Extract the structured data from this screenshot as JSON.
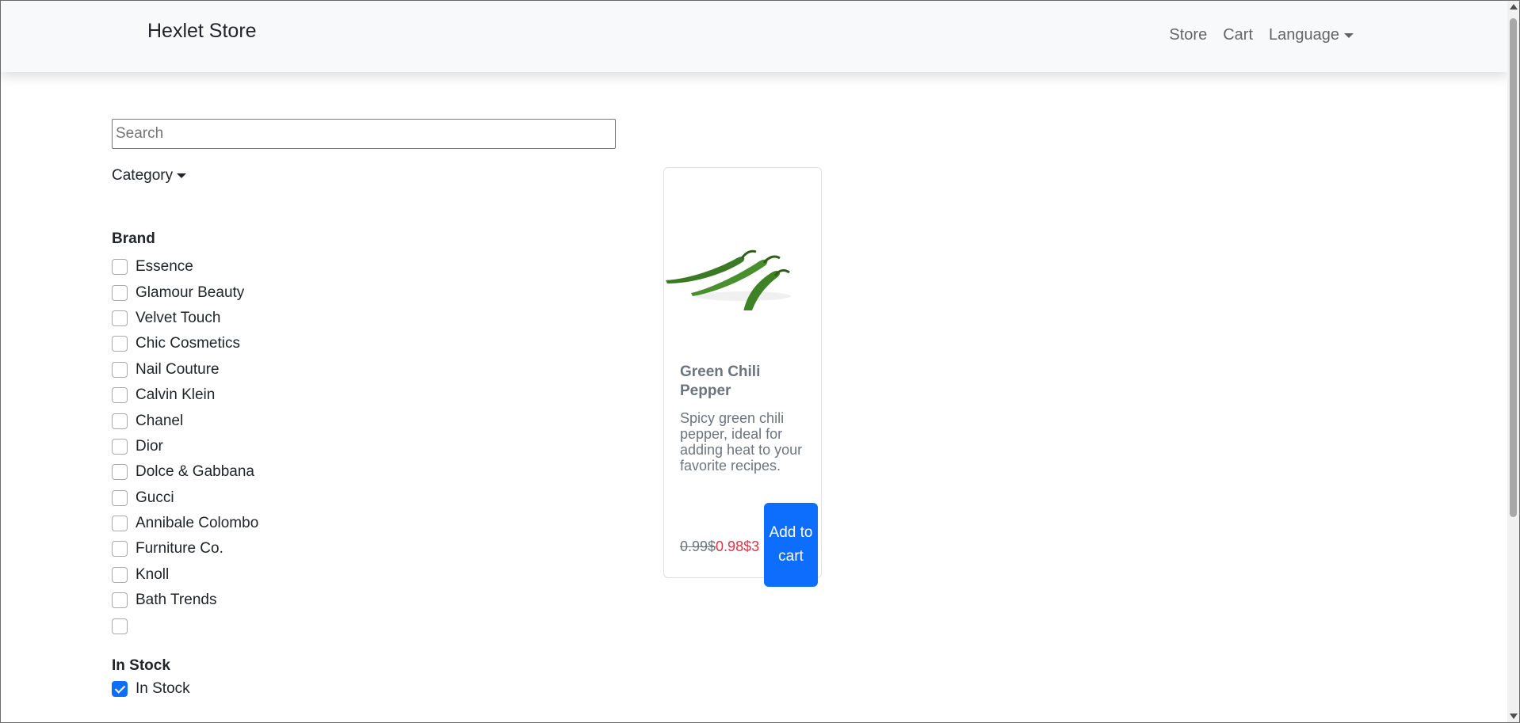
{
  "navbar": {
    "brand": "Hexlet Store",
    "links": {
      "store": "Store",
      "cart": "Cart",
      "language": "Language"
    }
  },
  "search": {
    "placeholder": "Search",
    "value": ""
  },
  "category": {
    "label": "Category"
  },
  "filters": {
    "brand_title": "Brand",
    "brands": [
      "Essence",
      "Glamour Beauty",
      "Velvet Touch",
      "Chic Cosmetics",
      "Nail Couture",
      "Calvin Klein",
      "Chanel",
      "Dior",
      "Dolce & Gabbana",
      "Gucci",
      "Annibale Colombo",
      "Furniture Co.",
      "Knoll",
      "Bath Trends",
      ""
    ],
    "stock_title": "In Stock",
    "stock_label": "In Stock",
    "stock_checked": true
  },
  "product": {
    "title": "Green Chili Pepper",
    "description": "Spicy green chili pepper, ideal for adding heat to your favorite recipes.",
    "old_price": "0.99$",
    "new_price": "0.98$",
    "extra": "3",
    "button_label": "Add to cart",
    "image_icon": "green-chili-pepper"
  },
  "colors": {
    "accent": "#0d6efd",
    "sale": "#dc3545",
    "muted": "#6c757d"
  }
}
